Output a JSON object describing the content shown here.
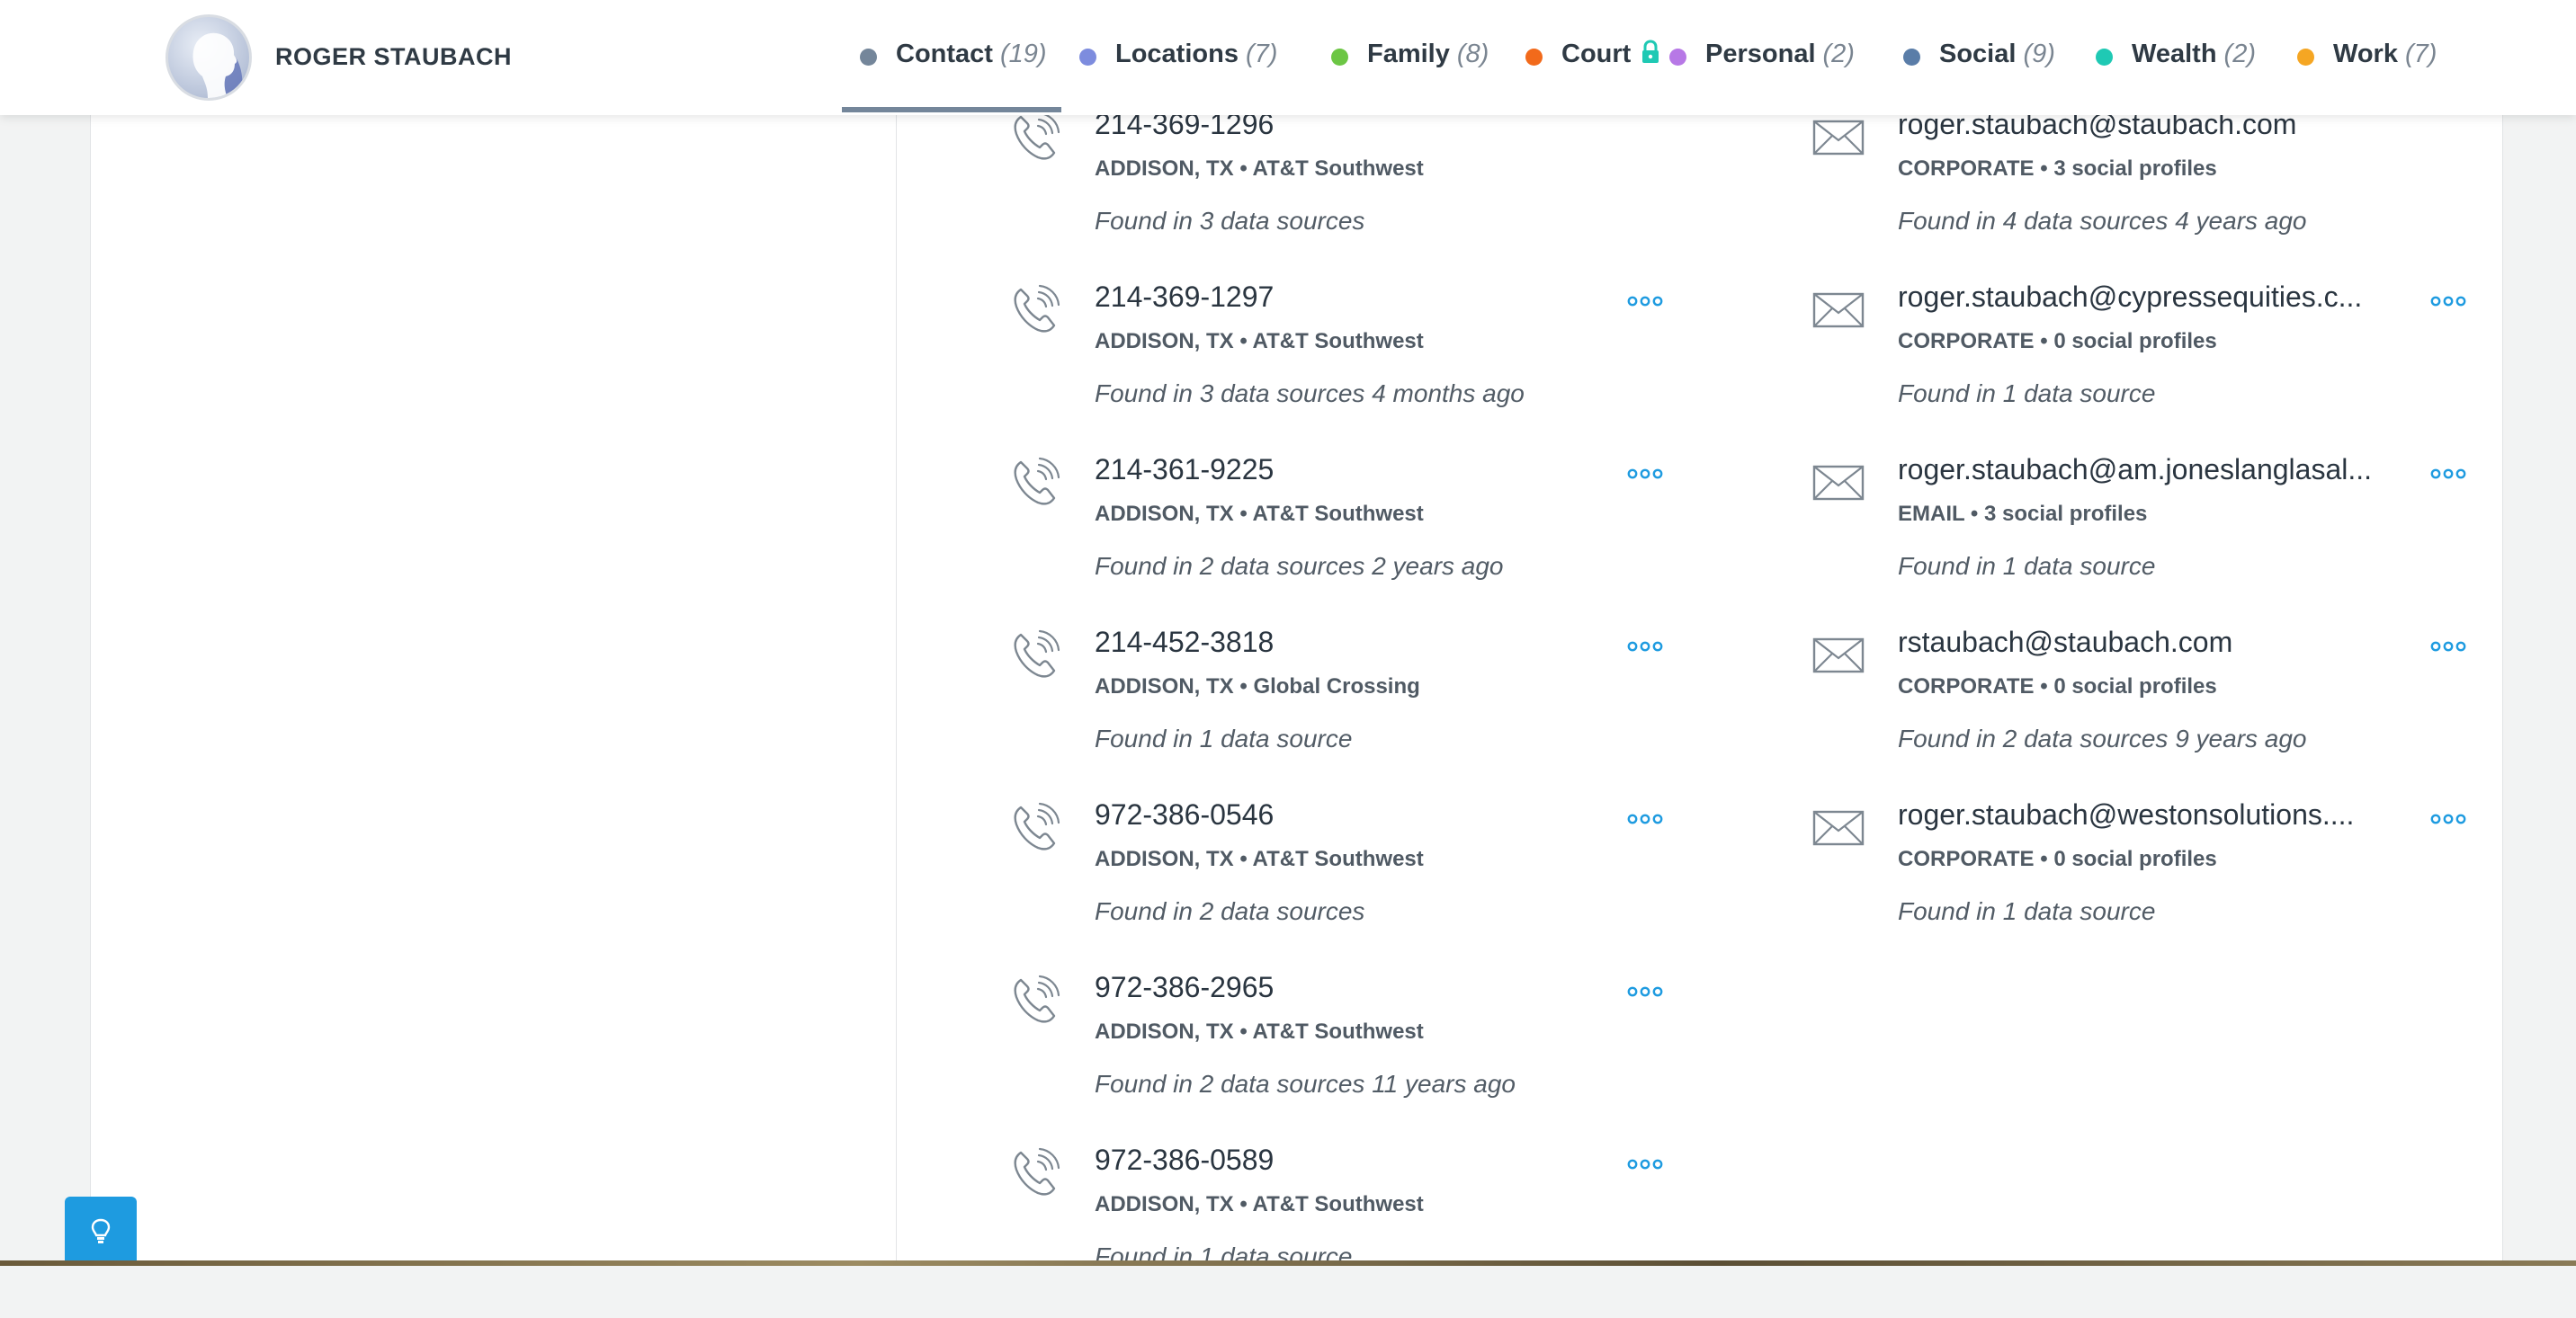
{
  "profile": {
    "name": "ROGER STAUBACH"
  },
  "tabs": [
    {
      "label": "Contact",
      "count": "(19)",
      "color": "#74869a",
      "active": true
    },
    {
      "label": "Locations",
      "count": "(7)",
      "color": "#7d8cde"
    },
    {
      "label": "Family",
      "count": "(8)",
      "color": "#6cc644"
    },
    {
      "label": "Court",
      "count": "",
      "color": "#f26a1b",
      "locked": true
    },
    {
      "label": "Personal",
      "count": "(2)",
      "color": "#b778e6"
    },
    {
      "label": "Social",
      "count": "(9)",
      "color": "#5a7da8"
    },
    {
      "label": "Wealth",
      "count": "(2)",
      "color": "#1fc9b4"
    },
    {
      "label": "Work",
      "count": "(7)",
      "color": "#f5a623"
    }
  ],
  "phones": [
    {
      "number": "214-369-1296",
      "location": "ADDISON, TX",
      "carrier": "AT&T Southwest",
      "sources": "Found in 3 data sources"
    },
    {
      "number": "214-369-1297",
      "location": "ADDISON, TX",
      "carrier": "AT&T Southwest",
      "sources": "Found in 3 data sources 4 months ago"
    },
    {
      "number": "214-361-9225",
      "location": "ADDISON, TX",
      "carrier": "AT&T Southwest",
      "sources": "Found in 2 data sources 2 years ago"
    },
    {
      "number": "214-452-3818",
      "location": "ADDISON, TX",
      "carrier": "Global Crossing",
      "sources": "Found in 1 data source"
    },
    {
      "number": "972-386-0546",
      "location": "ADDISON, TX",
      "carrier": "AT&T Southwest",
      "sources": "Found in 2 data sources"
    },
    {
      "number": "972-386-2965",
      "location": "ADDISON, TX",
      "carrier": "AT&T Southwest",
      "sources": "Found in 2 data sources 11 years ago"
    },
    {
      "number": "972-386-0589",
      "location": "ADDISON, TX",
      "carrier": "AT&T Southwest",
      "sources": "Found in 1 data source"
    }
  ],
  "emails": [
    {
      "address": "roger.staubach@staubach.com",
      "type": "CORPORATE",
      "profiles": "3 social profiles",
      "sources": "Found in 4 data sources 4 years ago"
    },
    {
      "address": "roger.staubach@cypressequities.c...",
      "type": "CORPORATE",
      "profiles": "0 social profiles",
      "sources": "Found in 1 data source"
    },
    {
      "address": "roger.staubach@am.joneslanglasal...",
      "type": "EMAIL",
      "profiles": "3 social profiles",
      "sources": "Found in 1 data source"
    },
    {
      "address": "rstaubach@staubach.com",
      "type": "CORPORATE",
      "profiles": "0 social profiles",
      "sources": "Found in 2 data sources 9 years ago"
    },
    {
      "address": "roger.staubach@westonsolutions....",
      "type": "CORPORATE",
      "profiles": "0 social profiles",
      "sources": "Found in 1 data source"
    }
  ],
  "icons": {
    "phone": "phone-icon",
    "email": "envelope-icon",
    "more": "more-options-icon",
    "lock": "lock-icon",
    "help": "lightbulb-icon"
  }
}
